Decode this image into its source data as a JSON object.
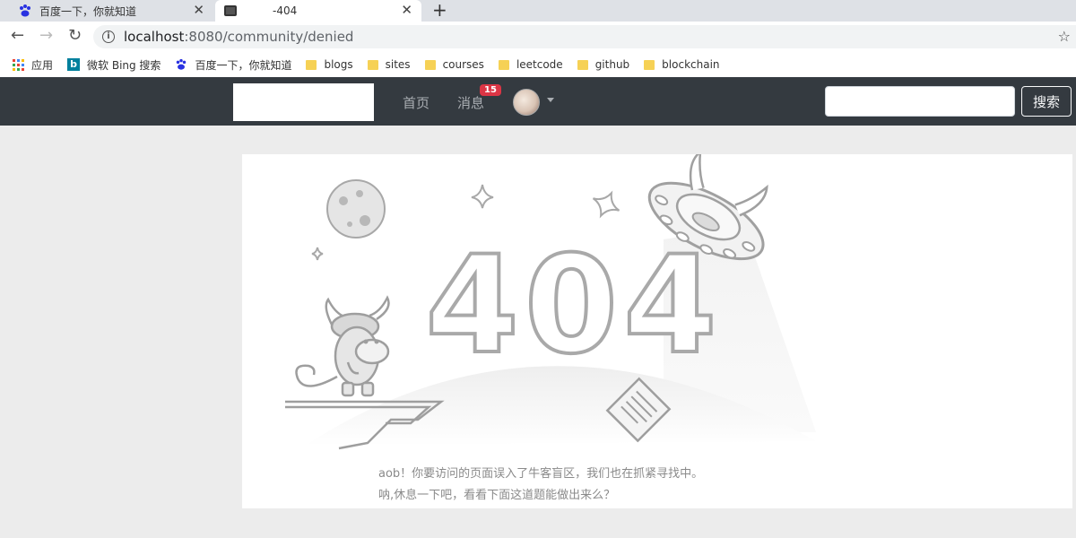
{
  "browser": {
    "tabs": [
      {
        "title": "百度一下，你就知道",
        "icon": "baidu-paw-icon"
      },
      {
        "title": "-404",
        "icon": "page-icon",
        "active": true
      }
    ],
    "new_tab": "+",
    "url_host": "localhost",
    "url_path": ":8080/community/denied",
    "bookmarks": [
      {
        "label": "应用",
        "icon": "apps-grid-icon"
      },
      {
        "label": "微软 Bing 搜索",
        "icon": "bing-icon"
      },
      {
        "label": "百度一下，你就知道",
        "icon": "baidu-paw-icon"
      },
      {
        "label": "blogs",
        "icon": "folder-icon"
      },
      {
        "label": "sites",
        "icon": "folder-icon"
      },
      {
        "label": "courses",
        "icon": "folder-icon"
      },
      {
        "label": "leetcode",
        "icon": "folder-icon"
      },
      {
        "label": "github",
        "icon": "folder-icon"
      },
      {
        "label": "blockchain",
        "icon": "folder-icon"
      }
    ]
  },
  "navbar": {
    "home": "首页",
    "messages": "消息",
    "badge_count": "15",
    "search_placeholder": "",
    "search_button": "搜索"
  },
  "error": {
    "code": "404",
    "line1": "aob！你要访问的页面误入了牛客盲区，我们也在抓紧寻找中。",
    "line2": "呐,休息一下吧，看看下面这道题能做出来么？"
  },
  "colors": {
    "navbar_bg": "#343a40",
    "badge": "#dc3545",
    "folder": "#f6d155"
  }
}
